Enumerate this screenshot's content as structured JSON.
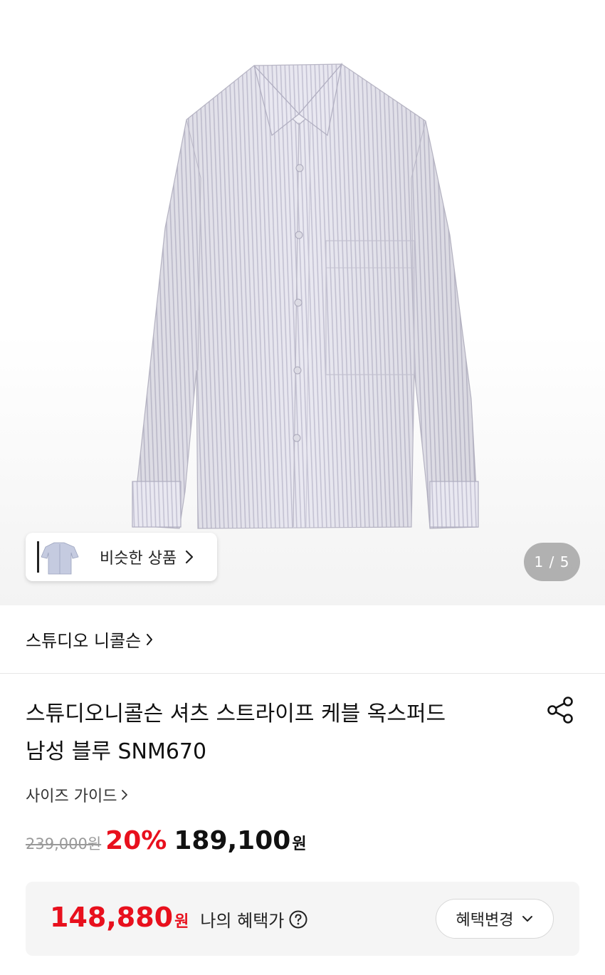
{
  "gallery": {
    "similar_label": "비슷한 상품",
    "page_indicator": "1 / 5",
    "current_page": 1,
    "total_pages": 5
  },
  "brand": {
    "name": "스튜디오 니콜슨"
  },
  "product": {
    "title_line1": "스튜디오니콜슨 셔츠 스트라이프 케블 옥스퍼드",
    "title_line2": "남성 블루 SNM670",
    "size_guide": "사이즈 가이드"
  },
  "price": {
    "original": "239,000원",
    "discount": "20%",
    "sale_number": "189,100",
    "sale_unit": "원"
  },
  "benefit": {
    "price_number": "148,880",
    "price_unit": "원",
    "label": "나의 혜택가",
    "change_button": "혜택변경"
  },
  "colors": {
    "accent_red": "#e8101d",
    "text_dark": "#111111",
    "muted": "#999999"
  },
  "icons": {
    "share": "share-icon",
    "help": "question-circle-icon",
    "chevron_right": "chevron-right-icon",
    "chevron_down": "chevron-down-icon"
  }
}
